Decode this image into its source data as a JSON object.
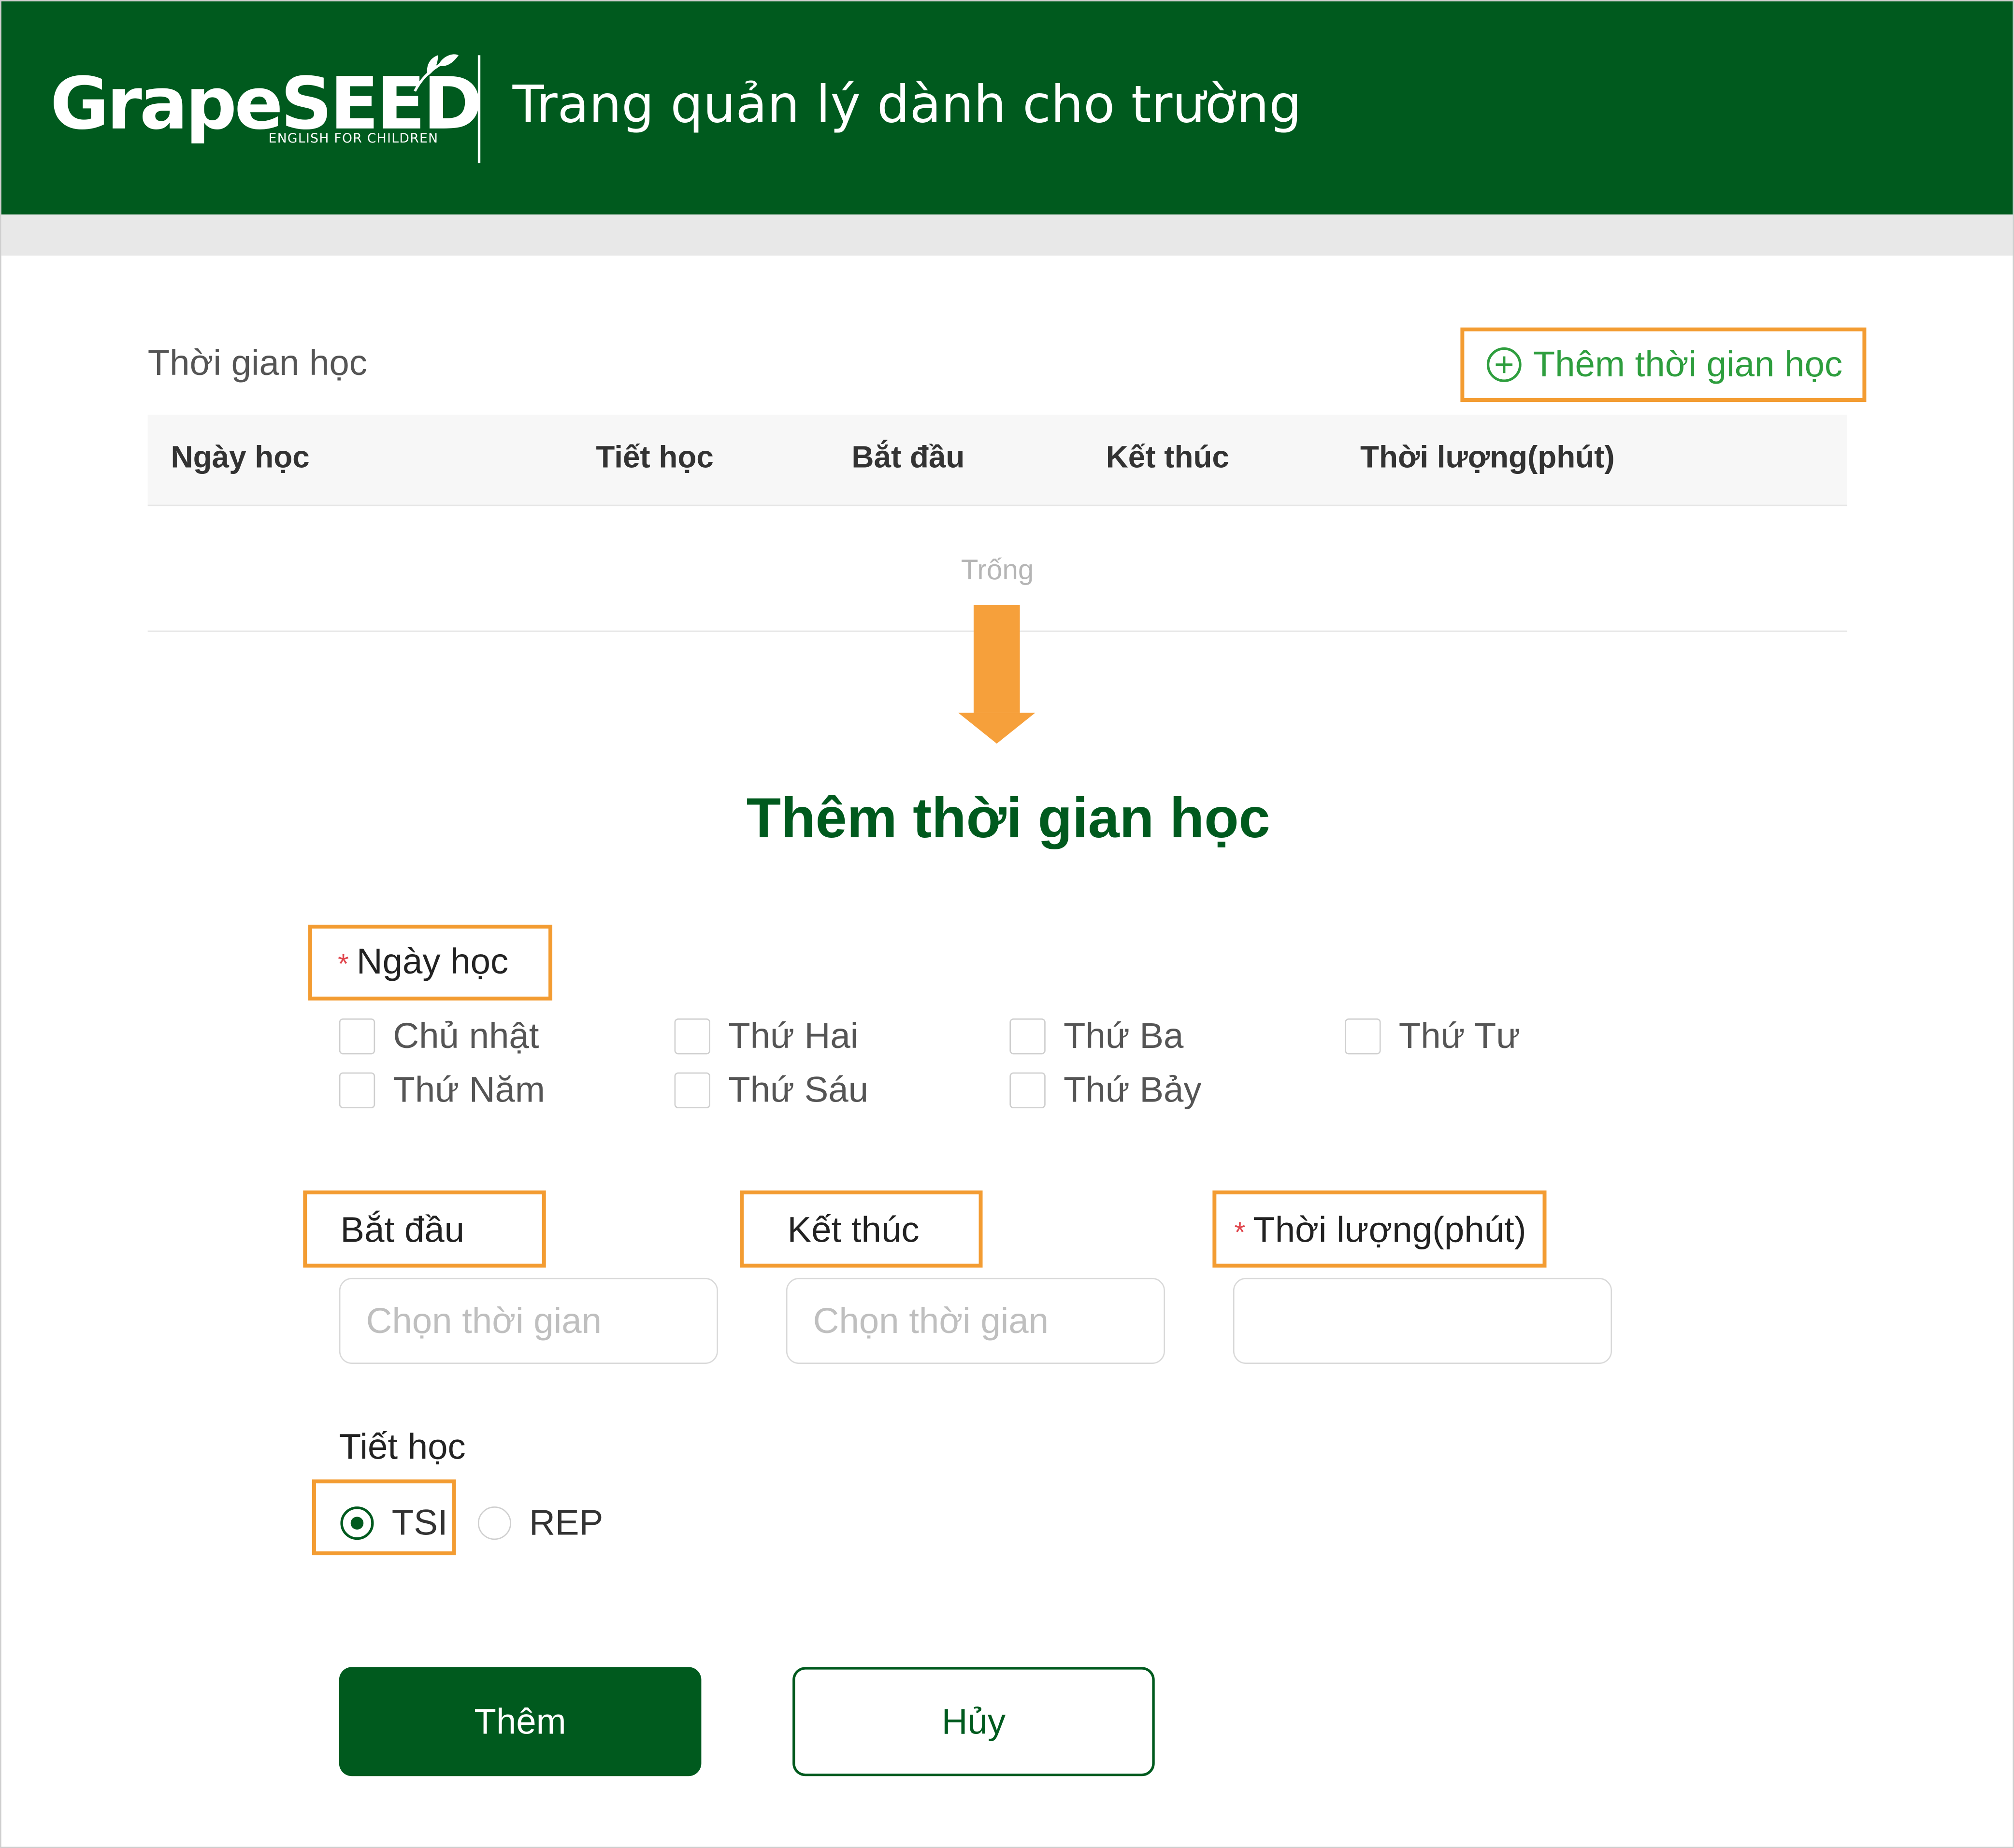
{
  "header": {
    "logo_text": "GrapeSEED",
    "logo_subtext": "ENGLISH FOR CHILDREN",
    "title": "Trang quản lý dành cho trường"
  },
  "section": {
    "title": "Thời gian học",
    "add_link": "Thêm thời gian học"
  },
  "table": {
    "columns": [
      "Ngày học",
      "Tiết học",
      "Bắt đầu",
      "Kết thúc",
      "Thời lượng(phút)"
    ],
    "empty_text": "Trống"
  },
  "form": {
    "title": "Thêm thời gian học",
    "days_label": "Ngày học",
    "days": [
      "Chủ nhật",
      "Thứ Hai",
      "Thứ Ba",
      "Thứ Tư",
      "Thứ Năm",
      "Thứ Sáu",
      "Thứ Bảy"
    ],
    "start_label": "Bắt đầu",
    "end_label": "Kết thúc",
    "duration_label": "Thời lượng(phút)",
    "start_placeholder": "Chọn thời gian",
    "end_placeholder": "Chọn thời gian",
    "duration_value": "",
    "lesson_label": "Tiết học",
    "lesson_options": [
      "TSI",
      "REP"
    ],
    "lesson_selected": "TSI",
    "submit_label": "Thêm",
    "cancel_label": "Hủy"
  },
  "colors": {
    "brand_green": "#005a1e",
    "link_green": "#2e9e3e",
    "highlight_orange": "#f39c32",
    "required_red": "#e0454c"
  },
  "icons": {
    "add": "plus-circle-icon",
    "arrow": "arrow-down-icon",
    "logo_leaf": "leaf-icon"
  }
}
